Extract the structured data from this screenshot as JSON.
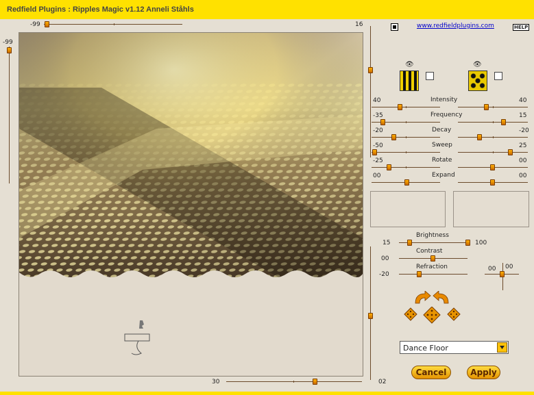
{
  "window": {
    "title": "Redfield Plugins : Ripples Magic v1.12   Anneli Ståhls"
  },
  "header": {
    "link": "www.redfieldplugins.com",
    "help": "HELP"
  },
  "preview": {
    "top_value": "-99",
    "top_right_value": "16",
    "left_value": "-99",
    "bottom_value": "30",
    "bottom_right_value": "02"
  },
  "sliders": [
    {
      "label": "Intensity",
      "left_value": "40",
      "right_value": "40"
    },
    {
      "label": "Frequency",
      "left_value": "-35",
      "right_value": "15"
    },
    {
      "label": "Decay",
      "left_value": "-20",
      "right_value": "-20"
    },
    {
      "label": "Sweep",
      "left_value": "-50",
      "right_value": "25"
    },
    {
      "label": "Rotate",
      "left_value": "-25",
      "right_value": "00"
    },
    {
      "label": "Expand",
      "left_value": "00",
      "right_value": "00"
    }
  ],
  "lighting": {
    "brightness_label": "Brightness",
    "brightness_left": "15",
    "brightness_right": "100",
    "contrast_label": "Contrast",
    "contrast_value": "00",
    "refraction_label": "Refraction",
    "refraction_value": "-20",
    "xy_value_1": "00",
    "xy_value_2": "00"
  },
  "preset": {
    "selected": "Dance Floor"
  },
  "buttons": {
    "cancel": "Cancel",
    "apply": "Apply"
  },
  "colors": {
    "title_bar": "#ffe100",
    "accent": "#f0a000",
    "link": "#0000cc"
  }
}
